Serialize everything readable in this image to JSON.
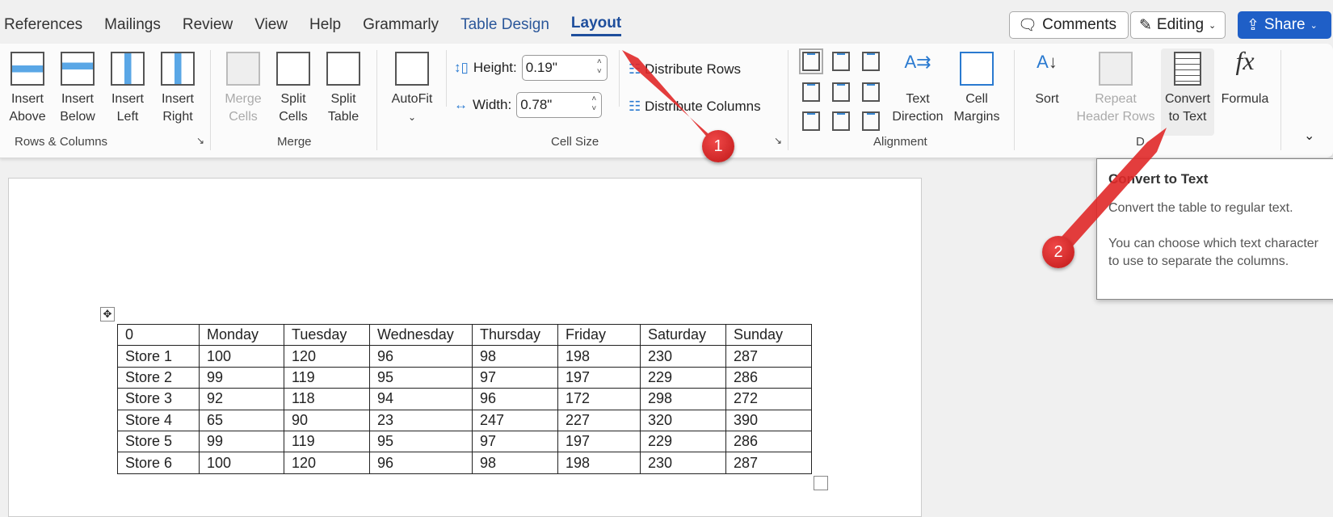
{
  "tabs": [
    "References",
    "Mailings",
    "Review",
    "View",
    "Help",
    "Grammarly",
    "Table Design",
    "Layout"
  ],
  "top_buttons": {
    "comments": "Comments",
    "editing": "Editing",
    "share": "Share"
  },
  "ribbon": {
    "rows_columns": {
      "label": "Rows & Columns",
      "buttons": [
        [
          "Insert",
          "Above"
        ],
        [
          "Insert",
          "Below"
        ],
        [
          "Insert",
          "Left"
        ],
        [
          "Insert",
          "Right"
        ]
      ]
    },
    "merge": {
      "label": "Merge",
      "buttons": [
        [
          "Merge",
          "Cells"
        ],
        [
          "Split",
          "Cells"
        ],
        [
          "Split",
          "Table"
        ]
      ]
    },
    "cell_size": {
      "label": "Cell Size",
      "autofit": "AutoFit",
      "height_label": "Height:",
      "height_value": "0.19\"",
      "width_label": "Width:",
      "width_value": "0.78\"",
      "distribute_rows": "Distribute Rows",
      "distribute_columns": "Distribute Columns"
    },
    "alignment": {
      "label": "Alignment",
      "text_direction": [
        "Text",
        "Direction"
      ],
      "cell_margins": [
        "Cell",
        "Margins"
      ]
    },
    "data": {
      "label": "D",
      "sort": "Sort",
      "repeat_header": [
        "Repeat",
        "Header Rows"
      ],
      "convert": [
        "Convert",
        "to Text"
      ],
      "formula": "Formula"
    }
  },
  "tooltip": {
    "title": "Convert to Text",
    "line1": "Convert the table to regular text.",
    "line2": "You can choose which text character to use to separate the columns."
  },
  "markers": [
    "1",
    "2"
  ],
  "table": {
    "header": [
      "0",
      "Monday",
      "Tuesday",
      "Wednesday",
      "Thursday",
      "Friday",
      "Saturday",
      "Sunday"
    ],
    "rows": [
      [
        "Store 1",
        "100",
        "120",
        "96",
        "98",
        "198",
        "230",
        "287"
      ],
      [
        "Store 2",
        "99",
        "119",
        "95",
        "97",
        "197",
        "229",
        "286"
      ],
      [
        "Store 3",
        "92",
        "118",
        "94",
        "96",
        "172",
        "298",
        "272"
      ],
      [
        "Store 4",
        "65",
        "90",
        "23",
        "247",
        "227",
        "320",
        "390"
      ],
      [
        "Store 5",
        "99",
        "119",
        "95",
        "97",
        "197",
        "229",
        "286"
      ],
      [
        "Store 6",
        "100",
        "120",
        "96",
        "98",
        "198",
        "230",
        "287"
      ]
    ]
  }
}
